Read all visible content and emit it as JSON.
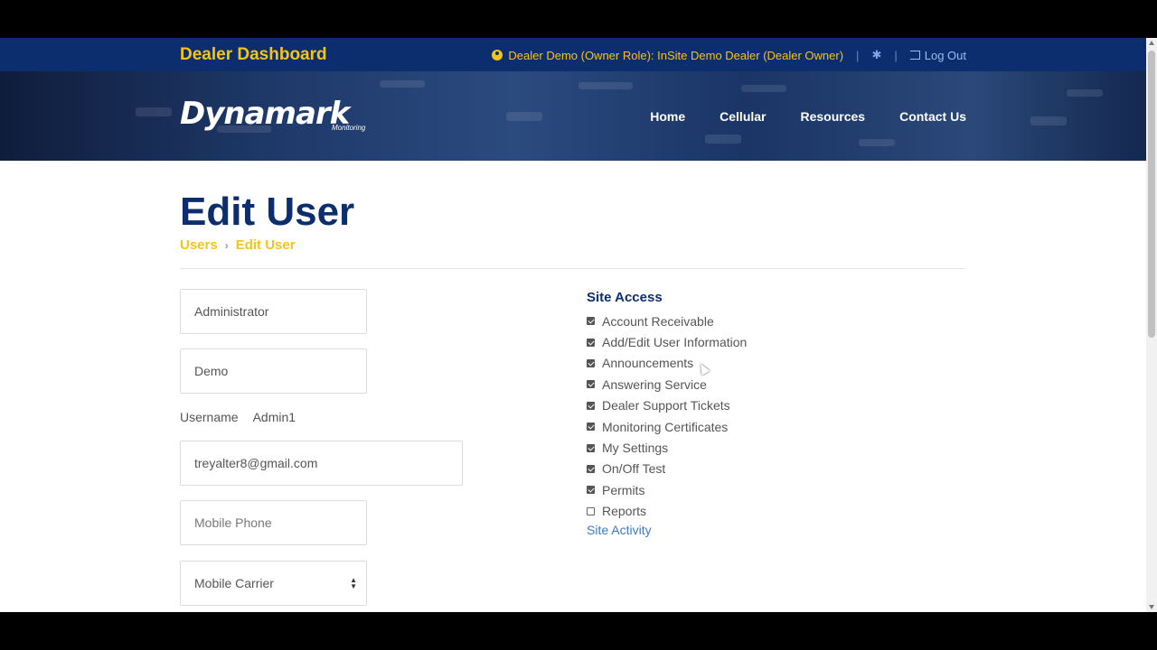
{
  "header": {
    "brand_title": "Dealer Dashboard",
    "user_label": "Dealer Demo (Owner Role): InSite Demo Dealer (Dealer Owner)",
    "separator": "|",
    "logout_label": "Log Out"
  },
  "hero": {
    "logo_text": "Dynamark",
    "logo_subtitle": "Monitoring",
    "nav": [
      "Home",
      "Cellular",
      "Resources",
      "Contact Us"
    ]
  },
  "page": {
    "title": "Edit User",
    "breadcrumb": [
      "Users",
      "Edit User"
    ],
    "breadcrumb_separator": "›"
  },
  "form": {
    "first_name": "Administrator",
    "last_name": "Demo",
    "username_label": "Username",
    "username_value": "Admin1",
    "email": "treyalter8@gmail.com",
    "mobile_phone_placeholder": "Mobile Phone",
    "mobile_carrier": "Mobile Carrier"
  },
  "site_access": {
    "heading": "Site Access",
    "items": [
      {
        "label": "Account Receivable",
        "checked": true
      },
      {
        "label": "Add/Edit User Information",
        "checked": true
      },
      {
        "label": "Announcements",
        "checked": true
      },
      {
        "label": "Answering Service",
        "checked": true
      },
      {
        "label": "Dealer Support Tickets",
        "checked": true
      },
      {
        "label": "Monitoring Certificates",
        "checked": true
      },
      {
        "label": "My Settings",
        "checked": true
      },
      {
        "label": "On/Off Test",
        "checked": true
      },
      {
        "label": "Permits",
        "checked": true
      },
      {
        "label": "Reports",
        "checked": false
      }
    ],
    "activity_link": "Site Activity"
  },
  "colors": {
    "navy": "#0c2e6e",
    "gold": "#f4c419",
    "link": "#3a7bc8"
  }
}
